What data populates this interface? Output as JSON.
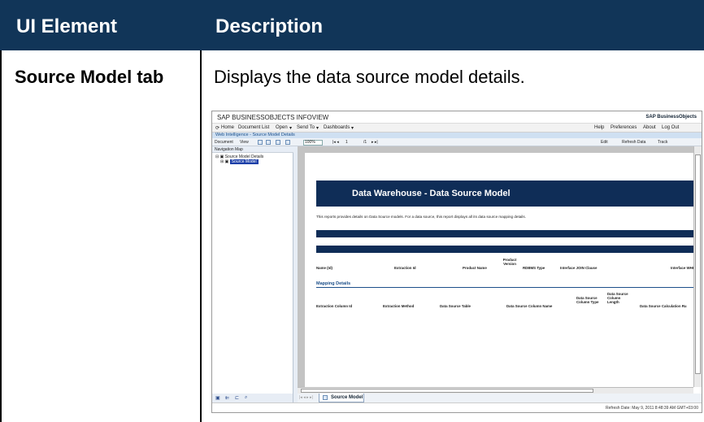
{
  "doc": {
    "header_col1": "UI Element",
    "header_col2": "Description",
    "element_name": "Source Model tab",
    "element_desc": "Displays the data source model details."
  },
  "screenshot": {
    "app_title": "SAP BUSINESSOBJECTS INFOVIEW",
    "brand": "SAP BusinessObjects",
    "menu": {
      "home": "Home",
      "document_list": "Document List",
      "open": "Open",
      "send_to": "Send To",
      "dashboards": "Dashboards",
      "help": "Help",
      "preferences": "Preferences",
      "about": "About",
      "log_out": "Log Out"
    },
    "wi_title": "Web Intelligence - Source Model Details",
    "toolbar": {
      "document": "Document",
      "view": "View",
      "zoom": "100%",
      "page": "1",
      "page_total": "/1",
      "edit": "Edit",
      "refresh_data": "Refresh Data",
      "track": "Track"
    },
    "nav_map": {
      "title": "Navigation Map",
      "root": "Source Model Details",
      "child": "Source Model"
    },
    "report": {
      "banner": "Data Warehouse - Data Source Model",
      "intro": "This reports provides details on Data Source models. For a data source, this report displays all its data source mapping details.",
      "columns1": [
        "Name (Id)",
        "Extraction Id",
        "Product Name",
        "Product Version",
        "RDBMS Type",
        "Interface JOIN Clause",
        "Interface WHE"
      ],
      "mapping_title": "Mapping Details",
      "columns2": [
        "Extraction Column Id",
        "Extraction Method",
        "Data Source Table",
        "Data Source Column Name",
        "Data Source Column Type",
        "Data Source Column Length",
        "Data Source Calculation Ru"
      ]
    },
    "tab_label": "Source Model",
    "status": "Refresh Date: May 9, 2011 8:48:39 AM GMT+03:00"
  },
  "colors": {
    "header_bg": "#113558",
    "banner_bg": "#0f2d57",
    "accent": "#1c4f8a"
  }
}
